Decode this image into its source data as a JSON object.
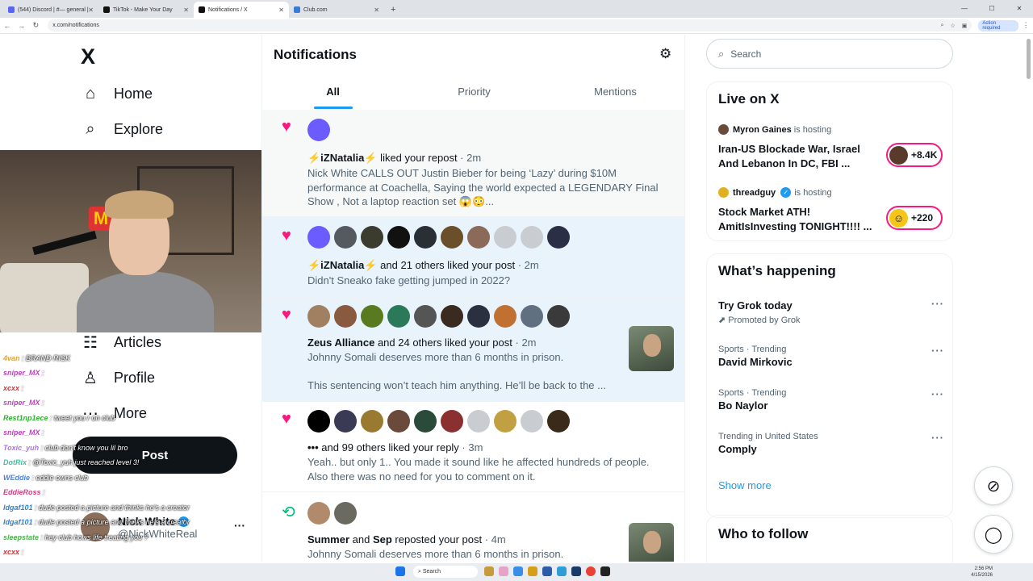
{
  "browser": {
    "tabs": [
      {
        "label": "(544) Discord | #— general |",
        "color": "#5865f2",
        "active": false
      },
      {
        "label": "TikTok - Make Your Day",
        "color": "#111111",
        "active": false
      },
      {
        "label": "Notifications / X",
        "color": "#111111",
        "active": true
      },
      {
        "label": "Club.com",
        "color": "#3a7bd5",
        "active": false
      }
    ],
    "new_tab": "+",
    "url": "x.com/notifications",
    "action_badge": "Action required"
  },
  "nav": {
    "logo": "X",
    "items": [
      {
        "label": "Home",
        "icon": "home-icon",
        "glyph": "⌂"
      },
      {
        "label": "Explore",
        "icon": "search-icon",
        "glyph": "⌕"
      },
      {
        "label": "Articles",
        "icon": "articles-icon",
        "glyph": "☷"
      },
      {
        "label": "Profile",
        "icon": "profile-icon",
        "glyph": "☺"
      },
      {
        "label": "More",
        "icon": "more-icon",
        "glyph": "⋯"
      }
    ],
    "post_label": "Post",
    "account": {
      "name": "Nick White",
      "handle": "@NickWhiteReal"
    }
  },
  "chat": [
    {
      "user": "",
      "msg": ""
    },
    {
      "user": "4van",
      "msg": "BRAND RISK",
      "color": "#e0a030"
    },
    {
      "user": "sniper_MX",
      "msg": "",
      "color": "#c040c0"
    },
    {
      "user": "xcxx",
      "msg": "",
      "color": "#d03030"
    },
    {
      "user": "sniper_MX",
      "msg": "",
      "color": "#c040c0"
    },
    {
      "user": "Rest1np1ece",
      "msg": "tweet you r on club",
      "color": "#30b030"
    },
    {
      "user": "sniper_MX",
      "msg": "",
      "color": "#c040c0"
    },
    {
      "user": "Toxic_yuh",
      "msg": "club don't know you lil bro",
      "color": "#b070e0"
    },
    {
      "user": "DotRix",
      "msg": "@Toxic_yuh just reached level 3!",
      "color": "#40c0a0"
    },
    {
      "user": "WEddie",
      "msg": "eddie owns club",
      "color": "#5080e0"
    },
    {
      "user": "EddieRoss",
      "msg": "",
      "color": "#d04080"
    },
    {
      "user": "ldgaf101",
      "msg": "dude posted a picture and thinks he's a creator",
      "color": "#3080d0"
    },
    {
      "user": "ldgaf101",
      "msg": "dude posted a picture and thinks he's a creator",
      "color": "#3080d0"
    },
    {
      "user": "sleepstate",
      "msg": "hey club hows life treating you ?",
      "color": "#50b050"
    },
    {
      "user": "xcxx",
      "msg": "",
      "color": "#d03030"
    }
  ],
  "center": {
    "title": "Notifications",
    "tabs": [
      "All",
      "Priority",
      "Mentions"
    ],
    "notifications": [
      {
        "kind": "like",
        "actor": "⚡iZNatalia⚡",
        "action": " liked your repost",
        "time": " · 2m",
        "snippet": "Nick White CALLS OUT Justin Bieber for being ‘Lazy’ during $10M performance at Coachella, Saying the world expected a LEGENDARY Final Show , Not a laptop reaction set 😱😳...",
        "avatars": [
          "#6b5cff"
        ]
      },
      {
        "kind": "like",
        "actor": "⚡iZNatalia⚡",
        "action": " and 21 others liked your post",
        "time": " · 2m",
        "snippet": "Didn't Sneako fake getting jumped in 2022?",
        "avatars": [
          "#6b5cff",
          "#555a60",
          "#3b3b30",
          "#111111",
          "#2a2e35",
          "#6b4f2a",
          "#8b6a5a",
          "#c9cdd2",
          "#c9cdd2",
          "#2b2f45"
        ]
      },
      {
        "kind": "like",
        "actor": "Zeus Alliance",
        "action": " and 24 others liked your post",
        "time": " · 2m",
        "snippet": "Johnny Somali deserves more than 6 months in prison.",
        "snippet2": "This sentencing won’t teach him anything. He’ll be back to the ...",
        "avatars": [
          "#a08060",
          "#8a5a40",
          "#5a7a20",
          "#2a7a5a",
          "#555555",
          "#3a2a20",
          "#2a3040",
          "#c07030",
          "#607080",
          "#3a3a3a"
        ]
      },
      {
        "kind": "like",
        "actor": "•••",
        "action": " and 99 others liked your reply",
        "time": " · 3m",
        "snippet": "Yeah.. but only 1.. You made it sound like he affected hundreds of people. Also there was no need for you to comment on it.",
        "avatars": [
          "#000000",
          "#3a3a55",
          "#9a7a30",
          "#6a4a3a",
          "#2a4a3a",
          "#8a3030",
          "#c9cdd2",
          "#c0a040",
          "#c9cdd2",
          "#3a2a1a"
        ]
      },
      {
        "kind": "repost",
        "actor": "Summer",
        "action": " and ",
        "actor2": "Sep",
        "action2": " reposted your post",
        "time": " · 4m",
        "snippet": "Johnny Somali deserves more than 6 months in prison.",
        "avatars": [
          "#b08a6a",
          "#6a6a60"
        ]
      }
    ]
  },
  "right": {
    "search_placeholder": "Search",
    "live": {
      "title": "Live on X",
      "spaces": [
        {
          "host": "Myron Gaines",
          "suffix": "is hosting",
          "title": "Iran-US Blockade War, Israel And Lebanon In DC, FBI ...",
          "count": "+8.4K",
          "host_color": "#6a4a3a"
        },
        {
          "host": "threadguy",
          "suffix": "is hosting",
          "title": "Stock Market ATH! AmitIsInvesting TONIGHT!!!! ...",
          "count": "+220",
          "host_color": "#e0b020"
        }
      ]
    },
    "happening": {
      "title": "What’s happening",
      "trends": [
        {
          "context": "",
          "title": "Try Grok today",
          "promo": "Promoted by Grok"
        },
        {
          "context": "Sports · Trending",
          "title": "David Mirkovic"
        },
        {
          "context": "Sports · Trending",
          "title": "Bo Naylor"
        },
        {
          "context": "Trending in United States",
          "title": "Comply"
        }
      ],
      "show_more": "Show more"
    },
    "follow_title": "Who to follow"
  },
  "taskbar": {
    "search": "Search",
    "time": "2:56 PM",
    "date": "4/15/2026"
  }
}
